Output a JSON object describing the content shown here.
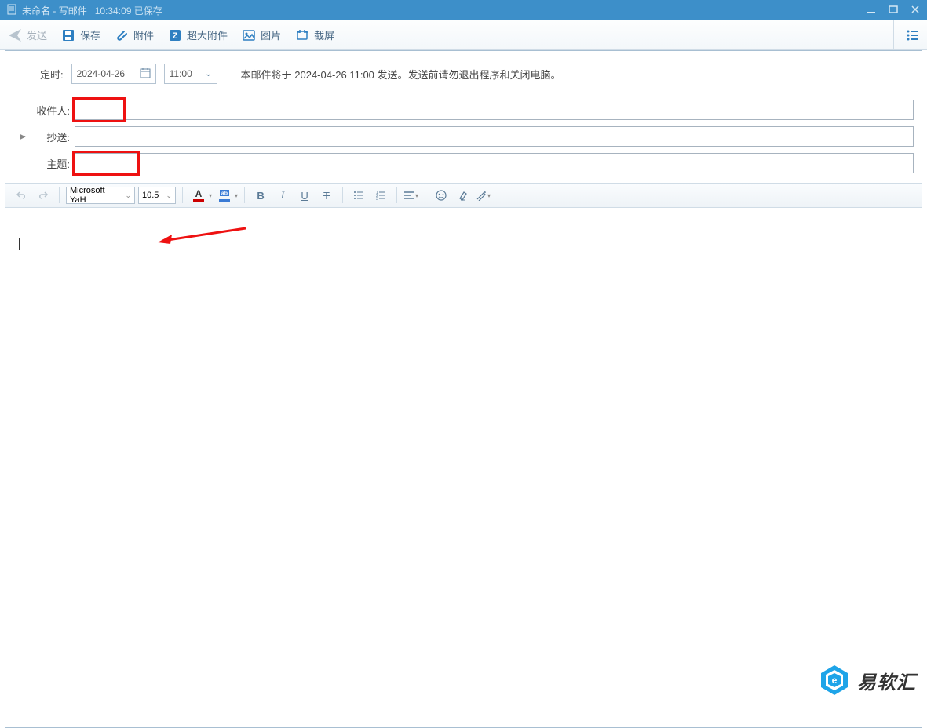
{
  "titlebar": {
    "doc_name": "未命名",
    "context": "写邮件",
    "time": "10:34:09",
    "saved": "已保存"
  },
  "toolbar": {
    "send": "发送",
    "save": "保存",
    "attach": "附件",
    "big_attach": "超大附件",
    "image": "图片",
    "screenshot": "截屏"
  },
  "timing": {
    "label": "定时:",
    "date": "2024-04-26",
    "time": "11:00",
    "info": "本邮件将于 2024-04-26 11:00 发送。发送前请勿退出程序和关闭电脑。"
  },
  "fields": {
    "to_label": "收件人:",
    "to_value": "",
    "cc_label": "抄送:",
    "cc_value": "",
    "subject_label": "主题:",
    "subject_value": ""
  },
  "editor": {
    "font_name": "Microsoft YaH",
    "font_size": "10.5"
  },
  "watermark": {
    "text": "易软汇"
  }
}
